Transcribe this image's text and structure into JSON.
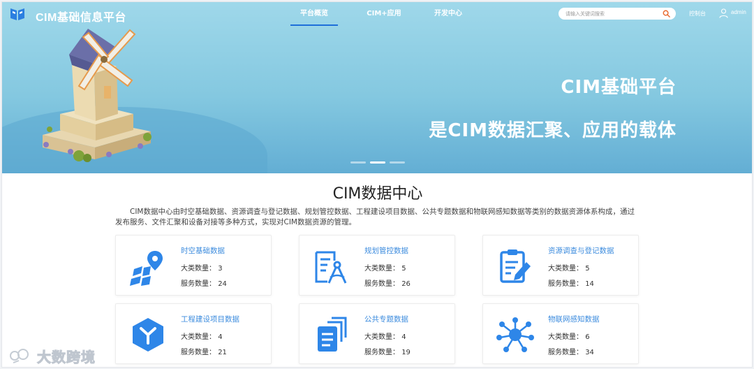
{
  "header": {
    "brand": "CIM基础信息平台",
    "nav": [
      {
        "label": "平台概览",
        "active": true
      },
      {
        "label": "CIM+应用",
        "active": false
      },
      {
        "label": "开发中心",
        "active": false
      }
    ],
    "search_placeholder": "请输入关键词搜索",
    "console_label": "控制台",
    "user_name": "admin"
  },
  "banner": {
    "line1": "CIM基础平台",
    "line2": "是CIM数据汇聚、应用的载体",
    "slide_count": 3,
    "active_slide": 1
  },
  "section": {
    "title": "CIM数据中心",
    "description": "CIM数据中心由时空基础数据、资源调查与登记数据、规划管控数据、工程建设项目数据、公共专题数据和物联网感知数据等类别的数据资源体系构成，通过发布服务、文件汇聚和设备对接等多种方式，实现对CIM数据资源的管理。"
  },
  "cards": [
    {
      "title": "时空基础数据",
      "category_label": "大类数量：",
      "category_value": "3",
      "service_label": "服务数量：",
      "service_value": "24",
      "icon": "map-location-icon"
    },
    {
      "title": "规划管控数据",
      "category_label": "大类数量：",
      "category_value": "5",
      "service_label": "服务数量：",
      "service_value": "26",
      "icon": "plan-compass-icon"
    },
    {
      "title": "资源调查与登记数据",
      "category_label": "大类数量：",
      "category_value": "5",
      "service_label": "服务数量：",
      "service_value": "14",
      "icon": "clipboard-edit-icon"
    },
    {
      "title": "工程建设项目数据",
      "category_label": "大类数量：",
      "category_value": "4",
      "service_label": "服务数量：",
      "service_value": "21",
      "icon": "hexagon-y-icon"
    },
    {
      "title": "公共专题数据",
      "category_label": "大类数量：",
      "category_value": "4",
      "service_label": "服务数量：",
      "service_value": "19",
      "icon": "document-stack-icon"
    },
    {
      "title": "物联网感知数据",
      "category_label": "大类数量：",
      "category_value": "6",
      "service_label": "服务数量：",
      "service_value": "34",
      "icon": "network-node-icon"
    }
  ],
  "watermark": {
    "text": "大数跨境"
  },
  "colors": {
    "accent": "#3d8cde",
    "nav_underline": "#1e6fd9",
    "icon_blue": "#2e86e8",
    "search_icon": "#e8692e"
  }
}
